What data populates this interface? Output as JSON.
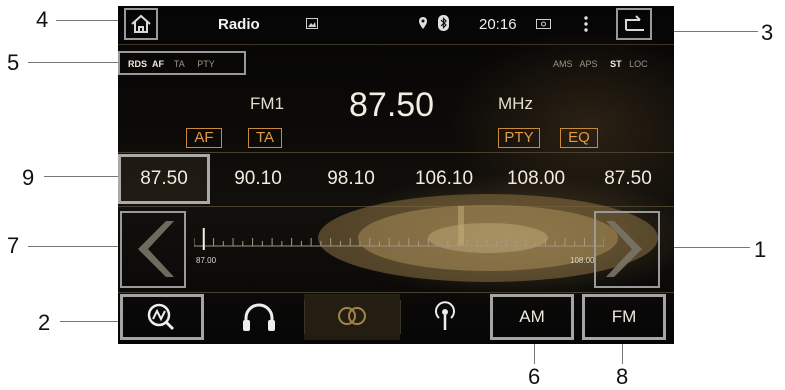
{
  "status_bar": {
    "title": "Radio",
    "time": "20:16"
  },
  "rds_flags": {
    "left": [
      "RDS",
      "AF",
      "TA",
      "PTY"
    ],
    "right": [
      "AMS",
      "APS",
      "ST",
      "LOC"
    ]
  },
  "tuner": {
    "band": "FM1",
    "frequency": "87.50",
    "unit": "MHz"
  },
  "tag_buttons": [
    "AF",
    "TA",
    "PTY",
    "EQ"
  ],
  "presets": [
    "87.50",
    "90.10",
    "98.10",
    "106.10",
    "108.00",
    "87.50"
  ],
  "scale": {
    "min_label": "87.00",
    "max_label": "108.00",
    "min": 87.0,
    "max": 108.0,
    "current": 87.5
  },
  "bottom_bar": {
    "am_label": "AM",
    "fm_label": "FM"
  },
  "callouts": [
    "1",
    "2",
    "3",
    "4",
    "5",
    "6",
    "7",
    "8",
    "9"
  ],
  "colors": {
    "accent_orange": "#e19a46",
    "frame_gray": "#a5a5a5",
    "background": "#0d0b08"
  },
  "icons": [
    "home-icon",
    "gallery-icon",
    "location-icon",
    "bluetooth-icon",
    "battery-icon",
    "menu-dots-icon",
    "back-icon",
    "search-scan-icon",
    "headphones-icon",
    "stereo-rings-icon",
    "antenna-icon",
    "prev-arrow-icon",
    "next-arrow-icon"
  ]
}
